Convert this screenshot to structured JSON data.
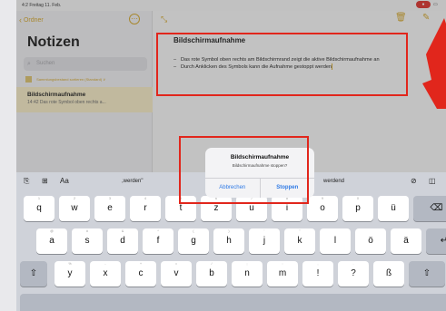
{
  "status_bar": {
    "time": "4:2  Freitag 11. Feb.",
    "rec": "●"
  },
  "sidebar": {
    "back_label": "Ordner",
    "title": "Notizen",
    "search_placeholder": "Suchen",
    "banner": "Sammlungsbestand sortieren (Standard) ∨",
    "note": {
      "title": "Bildschirmaufnahme",
      "time": "14:42",
      "preview": "Das rote Symbol oben rechts a..."
    }
  },
  "note": {
    "title": "Bildschirmaufnahme",
    "bullets": [
      "Das rote Symbol oben rechts am Bildschirmrand zeigt die aktive Bildschirmaufnahme an",
      "Durch Anklicken des Symbols kann die Aufnahme gestoppt werden"
    ]
  },
  "dialog": {
    "title": "Bildschirmaufnahme",
    "message": "Bildschirmaufnahme stoppen?",
    "cancel": "Abbrechen",
    "stop": "Stoppen"
  },
  "keyboard": {
    "format_label": "Aa",
    "predictions": [
      ",werden\"",
      "werdend"
    ],
    "row1": [
      {
        "l": "q",
        "s": "1"
      },
      {
        "l": "w",
        "s": "2"
      },
      {
        "l": "e",
        "s": "3"
      },
      {
        "l": "r",
        "s": "4"
      },
      {
        "l": "t",
        "s": "5"
      },
      {
        "l": "z",
        "s": "6"
      },
      {
        "l": "u",
        "s": "7"
      },
      {
        "l": "i",
        "s": "8"
      },
      {
        "l": "o",
        "s": "9"
      },
      {
        "l": "p",
        "s": "0"
      },
      {
        "l": "ü",
        "s": ""
      }
    ],
    "row2": [
      {
        "l": "a",
        "s": "@"
      },
      {
        "l": "s",
        "s": "#"
      },
      {
        "l": "d",
        "s": "&"
      },
      {
        "l": "f",
        "s": "*"
      },
      {
        "l": "g",
        "s": "("
      },
      {
        "l": "h",
        "s": ")"
      },
      {
        "l": "j",
        "s": "'"
      },
      {
        "l": "k",
        "s": "\""
      },
      {
        "l": "l",
        "s": ""
      },
      {
        "l": "ö",
        "s": ""
      },
      {
        "l": "ä",
        "s": ""
      }
    ],
    "row3": [
      {
        "l": "y",
        "s": "%"
      },
      {
        "l": "x",
        "s": "-"
      },
      {
        "l": "c",
        "s": "+"
      },
      {
        "l": "v",
        "s": "="
      },
      {
        "l": "b",
        "s": "/"
      },
      {
        "l": "n",
        "s": ";"
      },
      {
        "l": "m",
        "s": ":"
      },
      {
        "l": "!",
        "s": ","
      },
      {
        "l": "?",
        "s": "."
      },
      {
        "l": "ß",
        "s": ""
      }
    ],
    "backspace": "⌫",
    "return": "↵",
    "shift": "⇧"
  },
  "colors": {
    "accent": "#d7a92b",
    "annotation": "#e1261c",
    "link": "#2f7ae5"
  }
}
